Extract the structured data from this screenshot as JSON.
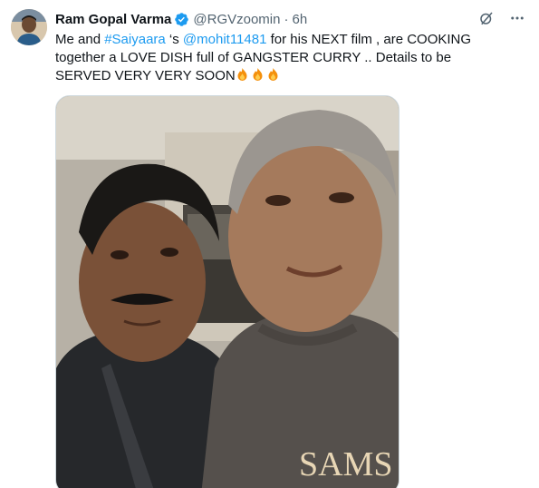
{
  "author": {
    "display_name": "Ram Gopal Varma",
    "handle": "@RGVzoomin",
    "separator": "·",
    "time": "6h",
    "avatar_icon": "profile-avatar",
    "verified_icon": "verified-badge-icon"
  },
  "tweet": {
    "text_1": "Me and ",
    "hashtag": "#Saiyaara",
    "text_2": " ‘s ",
    "mention": "@mohit11481",
    "text_3": " for his NEXT film  , are COOKING together a LOVE DISH full of GANGSTER CURRY .. Details to be SERVED VERY VERY SOON",
    "emoji_icons": [
      "fire-icon",
      "fire-icon",
      "fire-icon"
    ]
  },
  "media": {
    "shirt_text": "SAMS"
  },
  "actions": {
    "grok_icon": "grok-icon",
    "more_icon": "more-icon"
  },
  "colors": {
    "link": "#1d9bf0",
    "text": "#0f1419",
    "muted": "#536471"
  }
}
